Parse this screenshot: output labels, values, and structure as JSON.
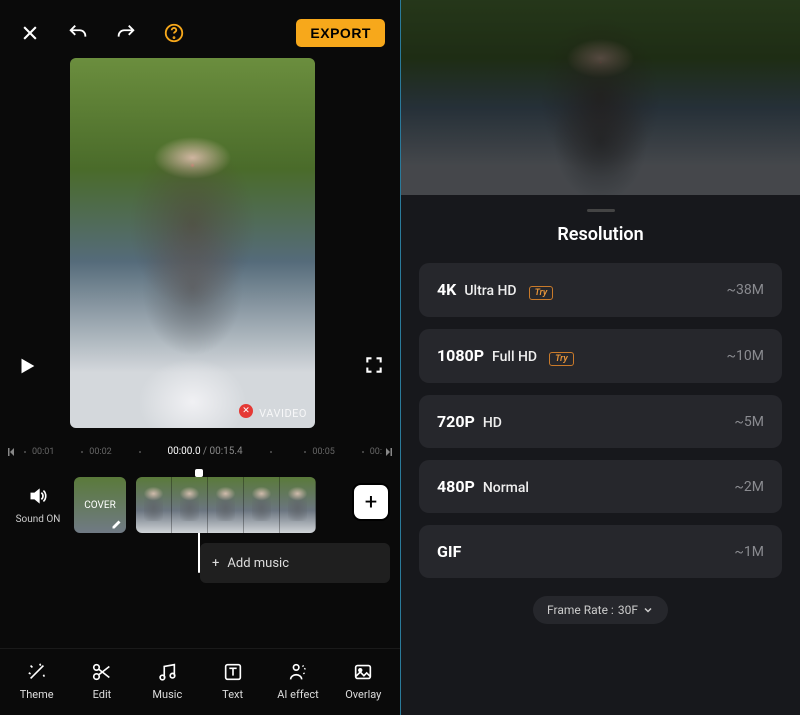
{
  "topbar": {
    "export_label": "EXPORT"
  },
  "preview": {
    "watermark": "VAVIDEO"
  },
  "timeline": {
    "marks": [
      "00:01",
      "00:02"
    ],
    "current": "00:00.0",
    "total": "00:15.4",
    "marks_right": [
      "00:05",
      "00:"
    ]
  },
  "tracks": {
    "sound_label": "Sound ON",
    "cover_label": "COVER",
    "add_music_label": "Add music"
  },
  "tabs": {
    "theme": "Theme",
    "edit": "Edit",
    "music": "Music",
    "text": "Text",
    "ai": "AI effect",
    "overlay": "Overlay"
  },
  "sheet": {
    "title": "Resolution",
    "items": [
      {
        "main": "4K",
        "sub": "Ultra HD",
        "try": true,
        "size": "~38M"
      },
      {
        "main": "1080P",
        "sub": "Full HD",
        "try": true,
        "size": "~10M"
      },
      {
        "main": "720P",
        "sub": "HD",
        "try": false,
        "size": "~5M"
      },
      {
        "main": "480P",
        "sub": "Normal",
        "try": false,
        "size": "~2M"
      },
      {
        "main": "GIF",
        "sub": "",
        "try": false,
        "size": "~1M"
      }
    ],
    "frame_rate_label": "Frame Rate :",
    "frame_rate_value": "30F",
    "try_badge": "Try"
  }
}
